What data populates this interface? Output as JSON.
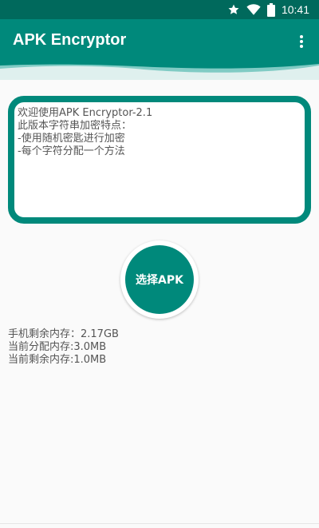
{
  "status_bar": {
    "time": "10:41",
    "icons": [
      "star-icon",
      "wifi-icon",
      "battery-icon"
    ],
    "background": "#00695c"
  },
  "app_bar": {
    "title": "APK Encryptor",
    "menu_icon": "more-vert-icon",
    "background": "#00897b"
  },
  "message_box": {
    "lines": [
      "欢迎使用APK Encryptor-2.1",
      "此版本字符串加密特点：",
      "-使用随机密匙进行加密",
      "-每个字符分配一个方法"
    ],
    "border_color": "#00897b"
  },
  "select_button": {
    "label": "选择APK"
  },
  "memory_info": {
    "lines": [
      "手机剩余内存：2.17GB",
      "当前分配内存:3.0MB",
      "当前剩余内存:1.0MB"
    ]
  },
  "colors": {
    "primary": "#00897b",
    "primary_dark": "#00695c",
    "accent_light": "#80cbc4",
    "wave_bg": "#dff0ee"
  }
}
